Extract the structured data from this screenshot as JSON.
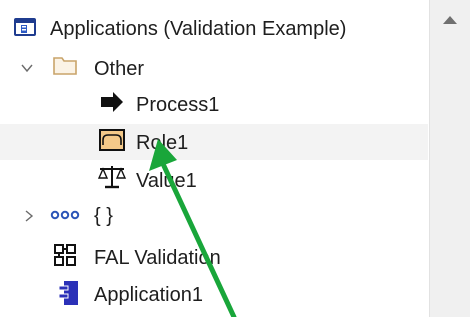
{
  "tree": {
    "root": {
      "label": "Applications (Validation Example)",
      "icon": "applications-folder-icon"
    },
    "other": {
      "label": "Other",
      "icon": "folder-icon",
      "caret": "expanded"
    },
    "process": {
      "label": "Process1",
      "icon": "process-arrow-icon"
    },
    "role": {
      "label": "Role1",
      "icon": "role-icon",
      "selected": true
    },
    "value": {
      "label": "Value1",
      "icon": "scales-icon"
    },
    "braces": {
      "label": "{ }",
      "icon": "ellipsis-icon",
      "caret": "collapsed"
    },
    "fal": {
      "label": "FAL Validation",
      "icon": "grid-icon"
    },
    "app": {
      "label": "Application1",
      "icon": "application-component-icon"
    }
  },
  "colors": {
    "selection": "#f3f3f3",
    "annotation_arrow": "#19a63a",
    "app_icon": "#2b31b8",
    "folder": "#c9a46a"
  }
}
